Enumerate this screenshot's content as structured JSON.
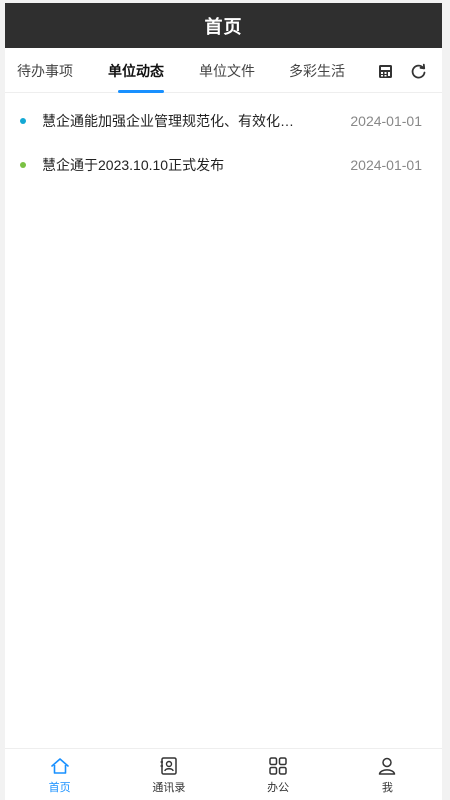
{
  "header": {
    "title": "首页"
  },
  "tabs": [
    {
      "label": "待办事项",
      "active": false
    },
    {
      "label": "单位动态",
      "active": true
    },
    {
      "label": "单位文件",
      "active": false
    },
    {
      "label": "多彩生活",
      "active": false
    }
  ],
  "toolbar_icons": [
    "calculator-icon",
    "refresh-icon"
  ],
  "news": [
    {
      "title": "慧企通能加强企业管理规范化、有效化、精细化",
      "date": "2024-01-01",
      "dot_color": "#13a8d4"
    },
    {
      "title": "慧企通于2023.10.10正式发布",
      "date": "2024-01-01",
      "dot_color": "#7ac143"
    }
  ],
  "tabbar": [
    {
      "label": "首页",
      "icon": "home-icon",
      "active": true
    },
    {
      "label": "通讯录",
      "icon": "contacts-icon",
      "active": false
    },
    {
      "label": "办公",
      "icon": "apps-icon",
      "active": false
    },
    {
      "label": "我",
      "icon": "user-icon",
      "active": false
    }
  ],
  "colors": {
    "accent": "#1890ff",
    "header_bg": "#2f2f2f"
  }
}
